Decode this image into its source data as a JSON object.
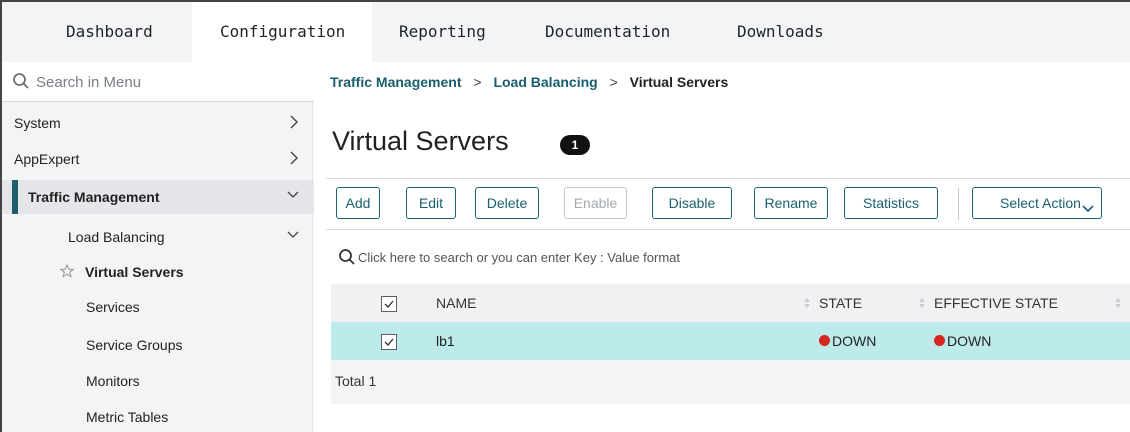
{
  "nav": {
    "tabs": [
      {
        "label": "Dashboard"
      },
      {
        "label": "Configuration"
      },
      {
        "label": "Reporting"
      },
      {
        "label": "Documentation"
      },
      {
        "label": "Downloads"
      }
    ],
    "active_tab": "Configuration"
  },
  "sidebar": {
    "search_placeholder": "Search in Menu",
    "items": [
      {
        "label": "System",
        "chevron": "chevron-right-icon"
      },
      {
        "label": "AppExpert",
        "chevron": "chevron-right-icon"
      },
      {
        "label": "Traffic Management",
        "chevron": "chevron-down-icon"
      },
      {
        "label": "Load Balancing",
        "chevron": "chevron-down-icon"
      },
      {
        "label": "Virtual Servers",
        "icon": "star-icon"
      },
      {
        "label": "Services"
      },
      {
        "label": "Service Groups"
      },
      {
        "label": "Monitors"
      },
      {
        "label": "Metric Tables"
      }
    ]
  },
  "breadcrumb": {
    "items": [
      "Traffic Management",
      "Load Balancing",
      "Virtual Servers"
    ],
    "separator": ">"
  },
  "page": {
    "title": "Virtual Servers",
    "count": "1"
  },
  "toolbar": {
    "add": "Add",
    "edit": "Edit",
    "delete": "Delete",
    "enable": "Enable",
    "disable": "Disable",
    "rename": "Rename",
    "statistics": "Statistics",
    "select_action": "Select Action"
  },
  "table": {
    "search_placeholder": "Click here to search or you can enter Key : Value format",
    "columns": [
      "NAME",
      "STATE",
      "EFFECTIVE STATE"
    ],
    "rows": [
      {
        "name": "lb1",
        "state": "DOWN",
        "effective_state": "DOWN",
        "selected": true
      }
    ],
    "total": "Total 1"
  },
  "colors": {
    "accent": "#1a5f70",
    "selected_row": "#bdeaea",
    "status_down": "#d7261e"
  }
}
